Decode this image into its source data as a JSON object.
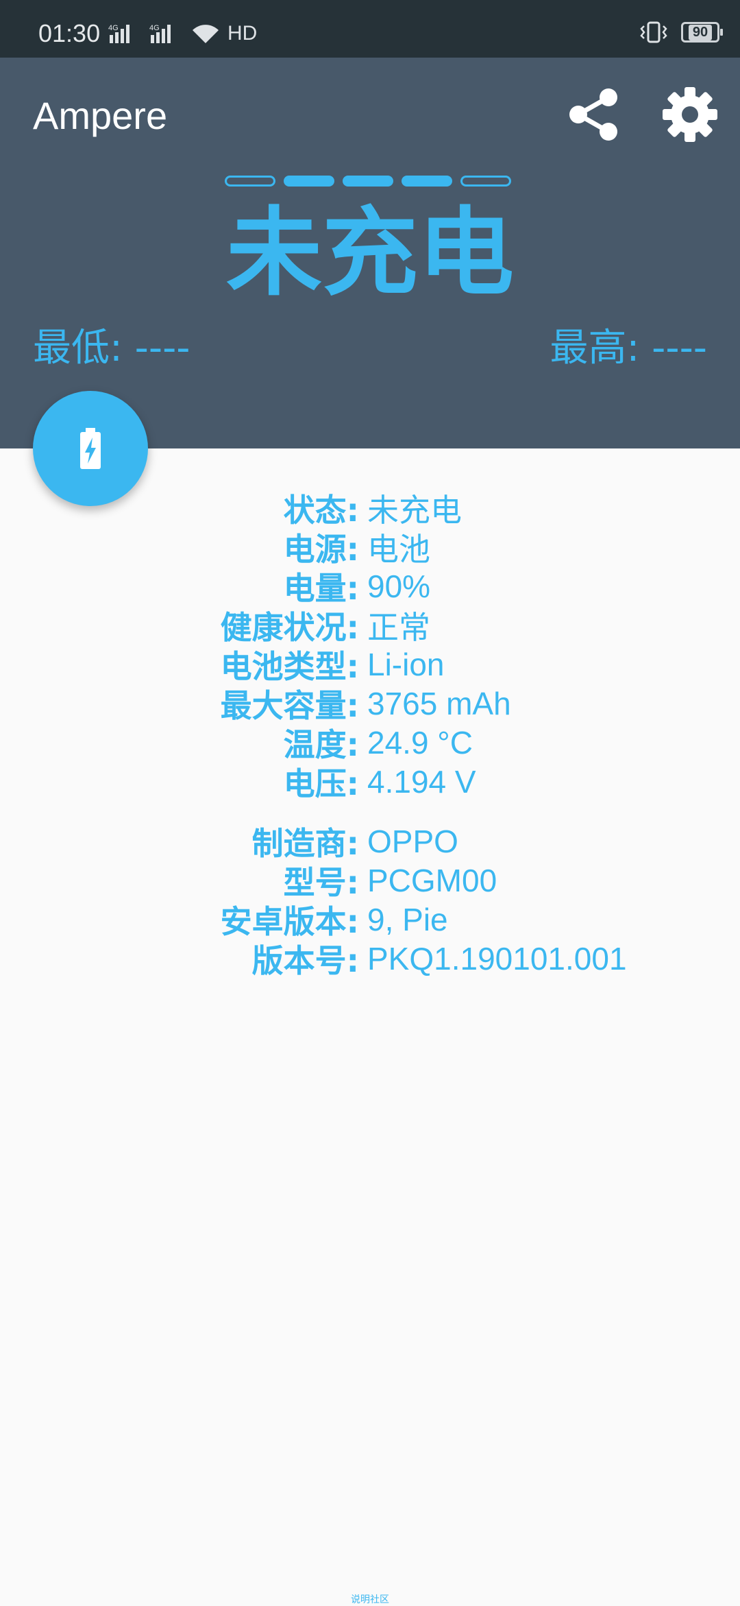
{
  "status_bar": {
    "time": "01:30",
    "net1": "4G",
    "net2": "4G",
    "hd": "HD",
    "battery": "90"
  },
  "app": {
    "title": "Ampere",
    "status": "未充电",
    "min_label": "最低: ----",
    "max_label": "最高: ----",
    "indicator": [
      false,
      true,
      true,
      true,
      false
    ]
  },
  "battery_info": [
    {
      "key": "状态:",
      "value": "未充电"
    },
    {
      "key": "电源:",
      "value": "电池"
    },
    {
      "key": "电量:",
      "value": "90%"
    },
    {
      "key": "健康状况:",
      "value": "正常"
    },
    {
      "key": "电池类型:",
      "value": "Li-ion"
    },
    {
      "key": "最大容量:",
      "value": "3765 mAh"
    },
    {
      "key": "温度:",
      "value": "24.9 °C"
    },
    {
      "key": "电压:",
      "value": "4.194 V"
    }
  ],
  "device_info": [
    {
      "key": "制造商:",
      "value": "OPPO"
    },
    {
      "key": "型号:",
      "value": "PCGM00"
    },
    {
      "key": "安卓版本:",
      "value": "9, Pie"
    },
    {
      "key": "版本号:",
      "value": "PKQ1.190101.001"
    }
  ],
  "footer": "说明社区",
  "colors": {
    "accent": "#3bb7f0",
    "appbar": "#48596a",
    "statusbar": "#263238"
  }
}
